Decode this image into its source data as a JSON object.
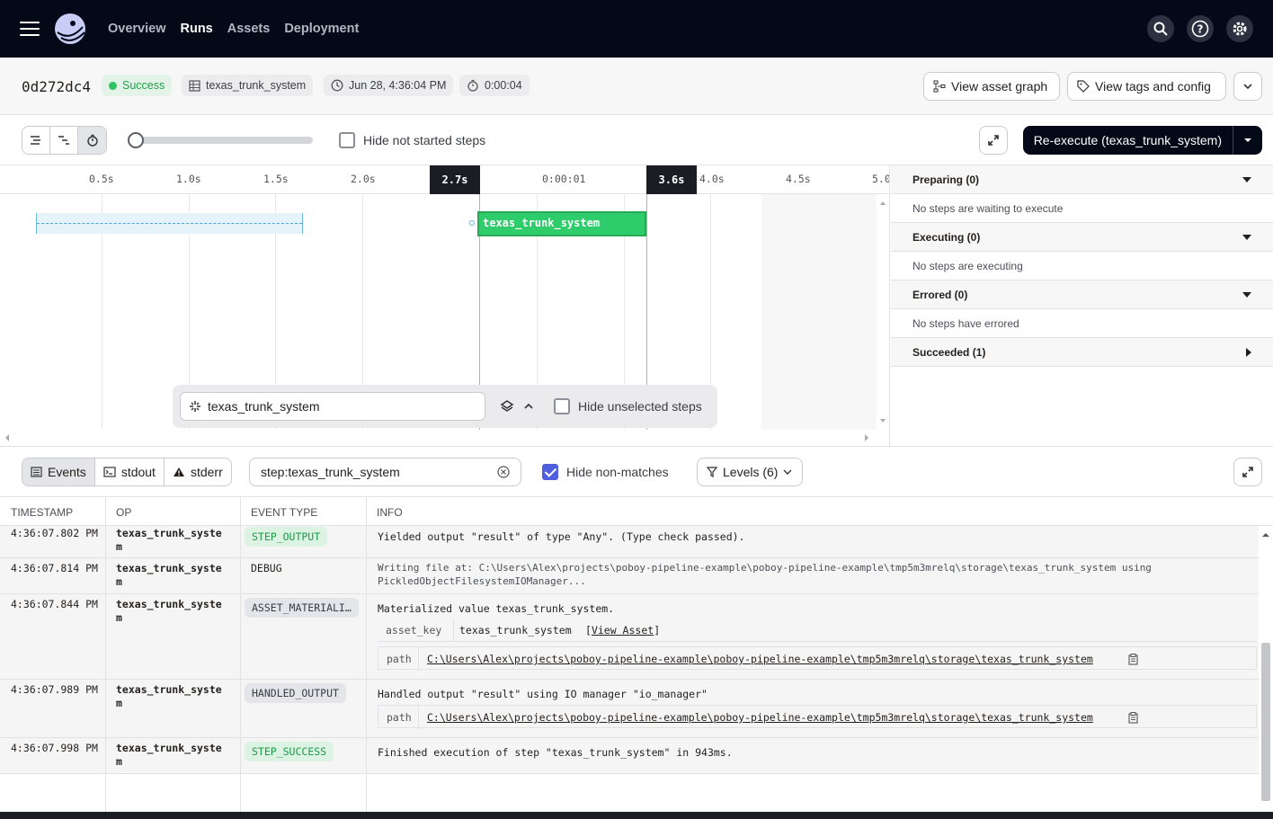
{
  "nav": {
    "links": [
      "Overview",
      "Runs",
      "Assets",
      "Deployment"
    ],
    "active": "Runs"
  },
  "run": {
    "id": "0d272dc4",
    "status": "Success",
    "job": "texas_trunk_system",
    "started": "Jun 28, 4:36:04 PM",
    "duration": "0:00:04",
    "view_asset_graph": "View asset graph",
    "view_tags": "View tags and config"
  },
  "toolbar": {
    "hide_not_started": "Hide not started steps",
    "reexecute": "Re-execute (texas_trunk_system)"
  },
  "gantt": {
    "ticks": [
      "0.5s",
      "1.0s",
      "1.5s",
      "2.0s",
      "0:00:01",
      "4.0s",
      "4.5s",
      "5.0"
    ],
    "markers": [
      "2.7s",
      "3.6s"
    ],
    "step_name": "texas_trunk_system",
    "filter_value": "texas_trunk_system",
    "hide_unselected": "Hide unselected steps"
  },
  "status_panel": {
    "sections": [
      {
        "title": "Preparing (0)",
        "body": "No steps are waiting to execute"
      },
      {
        "title": "Executing (0)",
        "body": "No steps are executing"
      },
      {
        "title": "Errored (0)",
        "body": "No steps have errored"
      },
      {
        "title": "Succeeded (1)",
        "body": ""
      }
    ]
  },
  "logs": {
    "tabs": [
      "Events",
      "stdout",
      "stderr"
    ],
    "active_tab": "Events",
    "search": "step:texas_trunk_system",
    "hide_non_matches": "Hide non-matches",
    "hide_non_matches_checked": true,
    "levels": "Levels (6)",
    "columns": [
      "TIMESTAMP",
      "OP",
      "EVENT TYPE",
      "INFO"
    ],
    "rows": [
      {
        "ts": "4:36:07.802 PM",
        "op1": "texas_trunk_syste",
        "op2": "m",
        "type": "STEP_OUTPUT",
        "info": "Yielded output \"result\" of type \"Any\". (Type check passed)."
      },
      {
        "ts": "4:36:07.814 PM",
        "op1": "texas_trunk_syste",
        "op2": "m",
        "type": "DEBUG",
        "info": "Writing file at: C:\\Users\\Alex\\projects\\poboy-pipeline-example\\poboy-pipeline-example\\tmp5m3mrelq\\storage\\texas_trunk_system using",
        "info2": "PickledObjectFilesystemIOManager..."
      },
      {
        "ts": "4:36:07.844 PM",
        "op1": "texas_trunk_syste",
        "op2": "m",
        "type": "ASSET_MATERIALI…",
        "info": "Materialized value texas_trunk_system.",
        "kv1_key": "asset_key",
        "kv1_val": "texas_trunk_system",
        "kv1_link": "View Asset",
        "kv2_key": "path",
        "kv2_val": "C:\\Users\\Alex\\projects\\poboy-pipeline-example\\poboy-pipeline-example\\tmp5m3mrelq\\storage\\texas_trunk_system"
      },
      {
        "ts": "4:36:07.989 PM",
        "op1": "texas_trunk_syste",
        "op2": "m",
        "type": "HANDLED_OUTPUT",
        "info": "Handled output \"result\" using IO manager \"io_manager\"",
        "kv1_key": "path",
        "kv1_val": "C:\\Users\\Alex\\projects\\poboy-pipeline-example\\poboy-pipeline-example\\tmp5m3mrelq\\storage\\texas_trunk_system"
      },
      {
        "ts": "4:36:07.998 PM",
        "op1": "texas_trunk_syste",
        "op2": "m",
        "type": "STEP_SUCCESS",
        "info": "Finished execution of step \"texas_trunk_system\" in 943ms."
      }
    ]
  },
  "colors": {
    "nav_bg": "#030917",
    "success": "#2fc363",
    "accent": "#4f5fe0"
  }
}
